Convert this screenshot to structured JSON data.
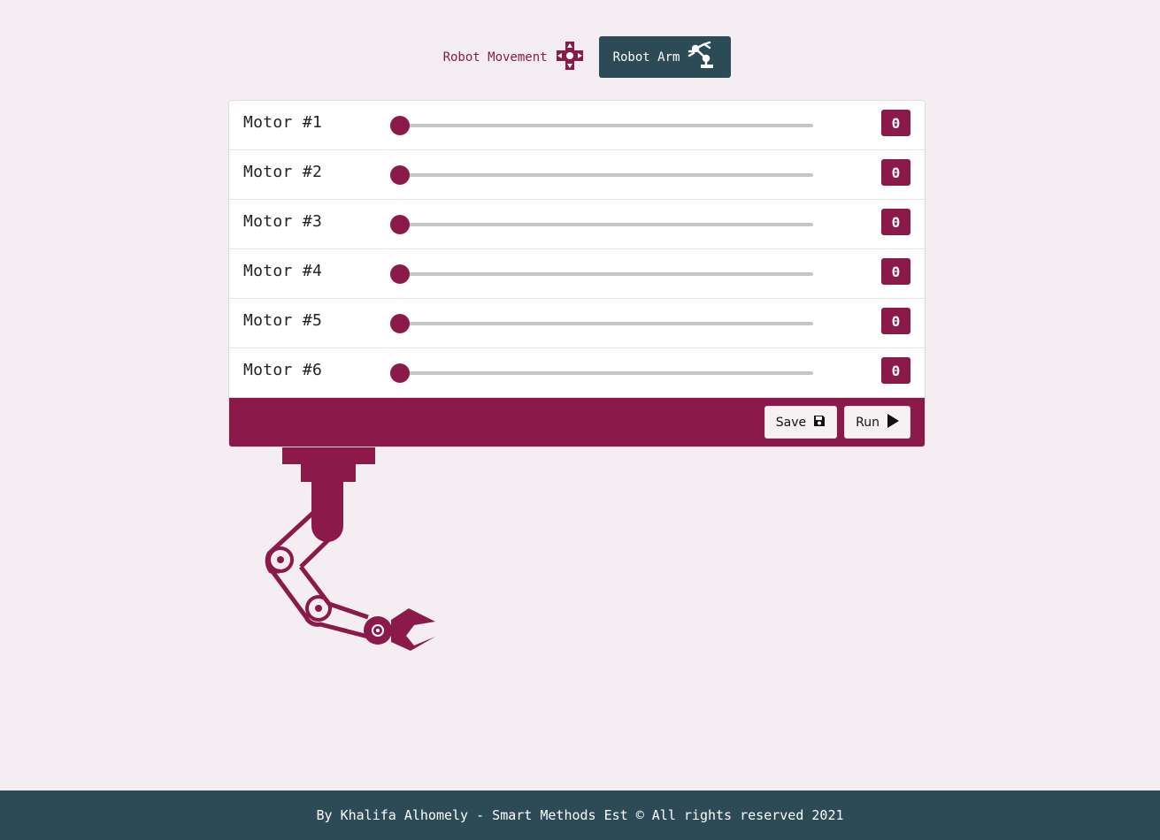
{
  "tabs": {
    "movement_label": "Robot Movement",
    "arm_label": "Robot Arm",
    "movement_icon": "dpad-icon",
    "arm_icon": "robot-arm-icon"
  },
  "motors": [
    {
      "label": "Motor #1",
      "value": "0"
    },
    {
      "label": "Motor #2",
      "value": "0"
    },
    {
      "label": "Motor #3",
      "value": "0"
    },
    {
      "label": "Motor #4",
      "value": "0"
    },
    {
      "label": "Motor #5",
      "value": "0"
    },
    {
      "label": "Motor #6",
      "value": "0"
    }
  ],
  "actions": {
    "save_label": "Save",
    "run_label": "Run"
  },
  "footer": {
    "text": "By Khalifa Alhomely - Smart Methods Est © All rights reserved 2021"
  },
  "colors": {
    "accent": "#8b1a4a",
    "dark": "#2d4b56",
    "background": "#f4eef2"
  }
}
